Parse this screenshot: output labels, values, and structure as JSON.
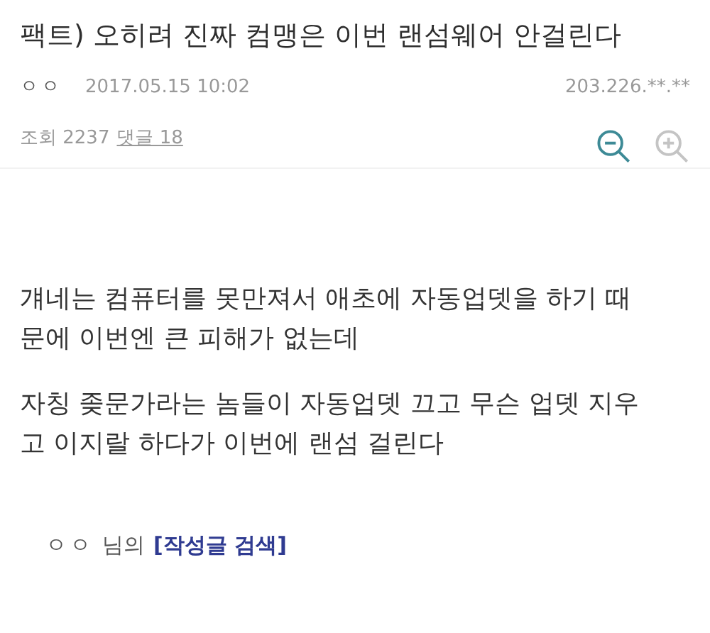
{
  "post": {
    "title": "팩트) 오히려 진짜 컴맹은 이번 랜섬웨어 안걸린다",
    "author": "ㅇㅇ",
    "date": "2017.05.15 10:02",
    "ip": "203.226.**.**",
    "views_label": "조회",
    "views": "2237",
    "comments_link": "댓글 18"
  },
  "zoom_buttons": [
    {
      "kind": "zoom-out",
      "disabled": false
    },
    {
      "kind": "zoom-in",
      "disabled": true
    }
  ],
  "body": [
    "걔네는 컴퓨터를 못만져서 애초에 자동업뎃을 하기 때문에 이번엔 큰 피해가 없는데",
    "자칭 좆문가라는 놈들이 자동업뎃 끄고 무슨 업뎃 지우고 이지랄 하다가 이번에 랜섬 걸린다"
  ],
  "footer": {
    "author": "ㅇㅇ",
    "suffix": "님의",
    "search_link": "[작성글 검색]"
  }
}
